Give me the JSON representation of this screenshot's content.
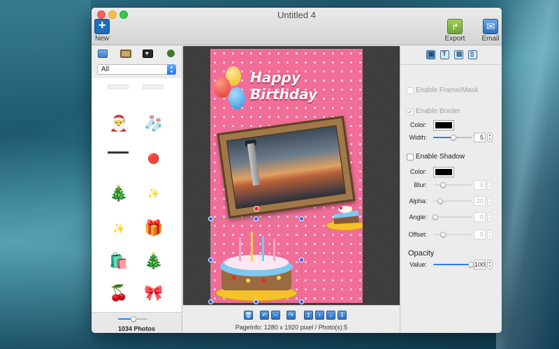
{
  "window": {
    "title": "Untitled 4"
  },
  "toolbar": {
    "new_label": "New",
    "export_label": "Export",
    "email_label": "Email"
  },
  "left_panel": {
    "category_icons": [
      "image-icon",
      "frame-icon",
      "heart-frame-icon",
      "clipart-icon"
    ],
    "category_select": {
      "value": "All",
      "arrow": "▴\n▾"
    },
    "stickers": [
      "🎅",
      "🧦",
      "🎄",
      "🎀",
      "✨",
      "🎁",
      "🛍️",
      "🎄",
      "🍒",
      "🎀"
    ],
    "size_slider": {
      "value": 0.6
    },
    "photo_count": "1034 Photos"
  },
  "canvas": {
    "card_title": "Happy Birthday",
    "selection_active": true
  },
  "bottom_toolbar": {
    "tools": [
      "trash-icon",
      "undo-icon",
      "minus-icon",
      "redo-icon",
      "move-up-icon",
      "bring-forward-icon",
      "send-backward-icon",
      "move-down-icon"
    ],
    "page_info": "PageInfo: 1280 x 1920 pixel / Photo(s):5"
  },
  "right_panel": {
    "tabs": [
      "photo-tab",
      "text-tab",
      "background-tab",
      "page-tab"
    ],
    "enable_frame_mask": {
      "label": "Enable Frame/Mask",
      "checked": false,
      "enabled": false
    },
    "enable_border": {
      "label": "Enable Border",
      "checked": true,
      "enabled": false
    },
    "border_color_label": "Color:",
    "border_color": "#000000",
    "border_width_label": "Width:",
    "border_width": "5",
    "enable_shadow": {
      "label": "Enable Shadow",
      "checked": false,
      "enabled": true
    },
    "shadow_color_label": "Color:",
    "shadow_color": "#000000",
    "blur_label": "Blur:",
    "blur_value": "5",
    "alpha_label": "Alpha:",
    "alpha_value": "20",
    "angle_label": "Angle:",
    "angle_value": "0",
    "offset_label": "Offset:",
    "offset_value": "5",
    "opacity_heading": "Opacity",
    "opacity_label": "Value:",
    "opacity_value": "100"
  }
}
